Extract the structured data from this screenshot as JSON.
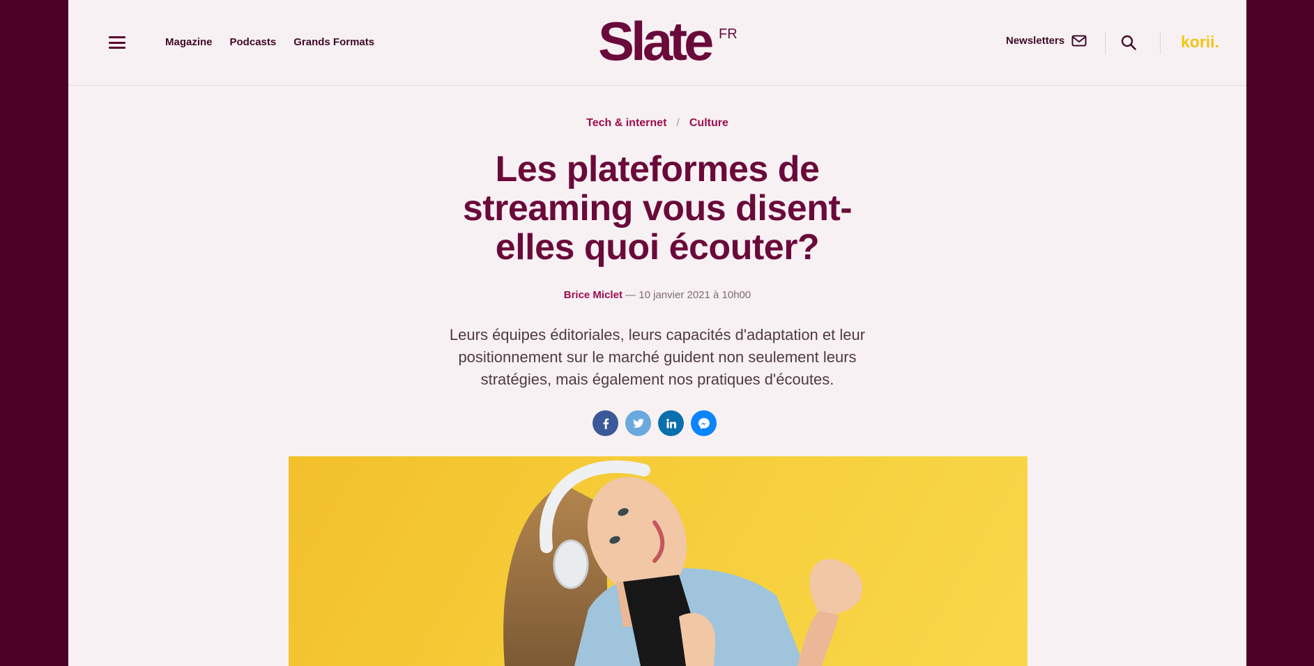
{
  "header": {
    "nav": [
      "Magazine",
      "Podcasts",
      "Grands Formats"
    ],
    "logo": "Slate",
    "logo_sup": "FR",
    "newsletters_label": "Newsletters",
    "korii_label": "korii."
  },
  "article": {
    "breadcrumbs": [
      "Tech & internet",
      "Culture"
    ],
    "title": "Les plateformes de streaming vous disent-elles quoi écouter?",
    "author": "Brice Miclet",
    "date": "— 10 janvier 2021 à 10h00",
    "lead": "Leurs équipes éditoriales, leurs capacités d'adaptation et leur positionnement sur le marché guident non seulement leurs stratégies, mais également nos pratiques d'écoutes."
  },
  "share": [
    {
      "name": "facebook",
      "glyph": "f",
      "color": "#3b5998"
    },
    {
      "name": "twitter",
      "glyph": "t",
      "color": "#55acee"
    },
    {
      "name": "linkedin",
      "glyph": "in",
      "color": "#0077b5"
    },
    {
      "name": "messenger",
      "glyph": "m",
      "color": "#0084ff"
    }
  ],
  "colors": {
    "brand": "#6a0a3a",
    "accent": "#9b0d4f",
    "frame": "#4d0026",
    "korii": "#f0c514"
  }
}
